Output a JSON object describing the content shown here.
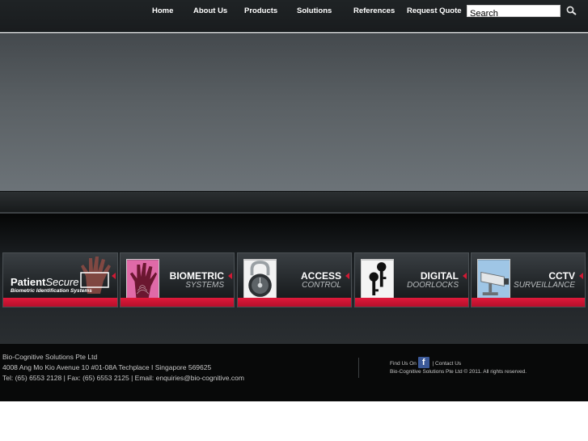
{
  "nav": {
    "items": [
      {
        "label": "Home"
      },
      {
        "label": "About Us"
      },
      {
        "label": "Products"
      },
      {
        "label": "Solutions"
      },
      {
        "label": "References"
      },
      {
        "label": "Request Quote"
      }
    ],
    "search": {
      "placeholder": "Search",
      "value": ""
    }
  },
  "products": {
    "patient_secure": {
      "name_bold": "Patient",
      "name_italic": "Secure",
      "sub": "Biometric Identification Systems"
    },
    "tiles": [
      {
        "line1": "BIOMETRIC",
        "line2": "SYSTEMS"
      },
      {
        "line1": "ACCESS",
        "line2": "CONTROL"
      },
      {
        "line1": "DIGITAL",
        "line2": "DOORLOCKS"
      },
      {
        "line1": "CCTV",
        "line2": "SURVEILLANCE"
      }
    ]
  },
  "footer": {
    "company": "Bio-Cognitive Solutions Pte Ltd",
    "address": "4008 Ang Mo Kio Avenue 10 #01-08A Techplace I Singapore 569625",
    "contact": "Tel: (65) 6553 2128 | Fax: (65) 6553 2125 | Email: enquiries@bio-cognitive.com",
    "find_us": "Find Us On",
    "facebook_glyph": "f",
    "separator": "|",
    "contact_link": "Contact Us",
    "copyright": "Bio-Cognitive Solutions Pte Ltd © 2011. All rights reserved."
  },
  "colors": {
    "accent_red": "#d01a34",
    "facebook_blue": "#3b5998"
  },
  "icons": {
    "search": "magnifier-icon",
    "facebook": "facebook-icon"
  }
}
